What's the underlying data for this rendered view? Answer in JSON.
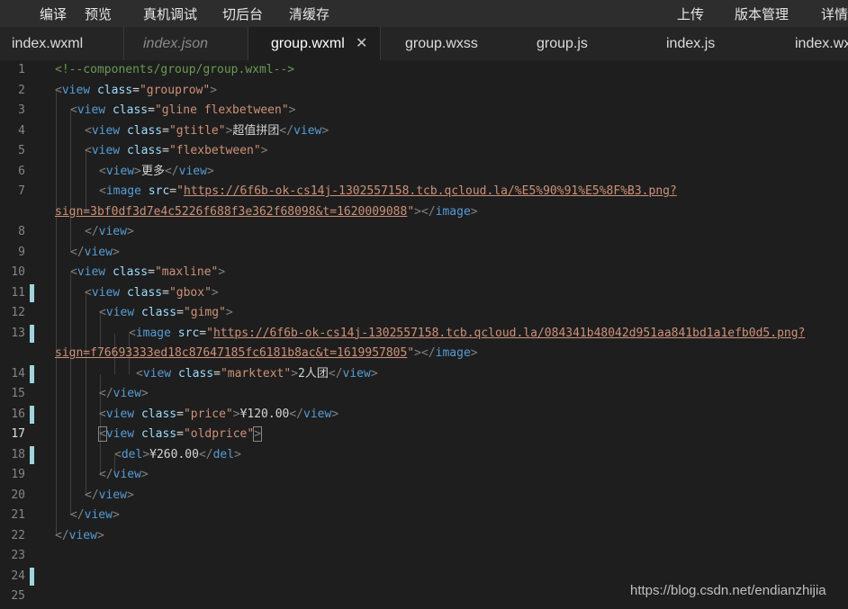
{
  "toolbar": {
    "compile": "编译",
    "preview": "预览",
    "remote_debug": "真机调试",
    "background": "切后台",
    "clear_cache": "清缓存",
    "upload": "上传",
    "version_mgmt": "版本管理",
    "details": "详情"
  },
  "tabs": [
    {
      "label": "index.wxml"
    },
    {
      "label": "index.json"
    },
    {
      "label": "group.wxml",
      "close": "✕"
    },
    {
      "label": "group.wxss"
    },
    {
      "label": "group.js"
    },
    {
      "label": "index.js"
    },
    {
      "label": "index.wxml"
    }
  ],
  "editor": {
    "line_numbers": [
      "1",
      "2",
      "3",
      "4",
      "5",
      "6",
      "7",
      "8",
      "9",
      "10",
      "11",
      "12",
      "13",
      "14",
      "15",
      "16",
      "17",
      "18",
      "19",
      "20",
      "21",
      "22",
      "23",
      "24",
      "25"
    ],
    "code": {
      "l1": {
        "comment": "<!--components/group/group.wxml-->"
      },
      "l2": {
        "open": "<",
        "tag": "view",
        "attr": "class",
        "eq": "=",
        "val": "\"grouprow\"",
        "close": ">"
      },
      "l3": {
        "open": "<",
        "tag": "view",
        "attr": "class",
        "eq": "=",
        "val": "\"gline flexbetween\"",
        "close": ">"
      },
      "l4": {
        "open": "<",
        "tag": "view",
        "attr": "class",
        "eq": "=",
        "val": "\"gtitle\"",
        "close": ">",
        "text": "超值拼团",
        "end_open": "</",
        "end_tag": "view",
        "end_close": ">"
      },
      "l5": {
        "open": "<",
        "tag": "view",
        "attr": "class",
        "eq": "=",
        "val": "\"flexbetween\"",
        "close": ">"
      },
      "l6": {
        "open": "<",
        "tag": "view",
        "close": ">",
        "text": "更多",
        "end_open": "</",
        "end_tag": "view",
        "end_close": ">"
      },
      "l7a": {
        "open": "<",
        "tag": "image",
        "attr": "src",
        "eq": "=",
        "q": "\"",
        "url": "https://6f6b-ok-cs14j-1302557158.tcb.qcloud.la/%E5%90%91%E5%8F%B3.png?"
      },
      "l7b": {
        "url": "sign=3bf0df3d7e4c5226f688f3e362f68098&t=1620009088",
        "q": "\"",
        "close": ">",
        "end_open": "</",
        "end_tag": "image",
        "end_close": ">"
      },
      "l8": {
        "end_open": "</",
        "end_tag": "view",
        "end_close": ">"
      },
      "l9": {
        "end_open": "</",
        "end_tag": "view",
        "end_close": ">"
      },
      "l10": {
        "open": "<",
        "tag": "view",
        "attr": "class",
        "eq": "=",
        "val": "\"maxline\"",
        "close": ">"
      },
      "l11": {
        "open": "<",
        "tag": "view",
        "attr": "class",
        "eq": "=",
        "val": "\"gbox\"",
        "close": ">"
      },
      "l12": {
        "open": "<",
        "tag": "view",
        "attr": "class",
        "eq": "=",
        "val": "\"gimg\"",
        "close": ">"
      },
      "l13a": {
        "open": "<",
        "tag": "image",
        "attr": "src",
        "eq": "=",
        "q": "\"",
        "url": "https://6f6b-ok-cs14j-1302557158.tcb.qcloud.la/084341b48042d951aa841bd1a1efb0d5.png?"
      },
      "l13b": {
        "url": "sign=f76693333ed18c87647185fc6181b8ac&t=1619957805",
        "q": "\"",
        "close": ">",
        "end_open": "</",
        "end_tag": "image",
        "end_close": ">"
      },
      "l14": {
        "open": "<",
        "tag": "view",
        "attr": "class",
        "eq": "=",
        "val": "\"marktext\"",
        "close": ">",
        "text": "2人团",
        "end_open": "</",
        "end_tag": "view",
        "end_close": ">"
      },
      "l15": {
        "end_open": "</",
        "end_tag": "view",
        "end_close": ">"
      },
      "l16": {
        "open": "<",
        "tag": "view",
        "attr": "class",
        "eq": "=",
        "val": "\"price\"",
        "close": ">",
        "text": "¥120.00",
        "end_open": "</",
        "end_tag": "view",
        "end_close": ">"
      },
      "l17": {
        "open": "<",
        "tag": "view",
        "attr": "class",
        "eq": "=",
        "val": "\"oldprice\"",
        "close": ">"
      },
      "l18": {
        "open": "<",
        "tag": "del",
        "close": ">",
        "text": "¥260.00",
        "end_open": "</",
        "end_tag": "del",
        "end_close": ">"
      },
      "l19": {
        "end_open": "</",
        "end_tag": "view",
        "end_close": ">"
      },
      "l20": {
        "end_open": "</",
        "end_tag": "view",
        "end_close": ">"
      },
      "l21": {
        "end_open": "</",
        "end_tag": "view",
        "end_close": ">"
      },
      "l22": {
        "end_open": "</",
        "end_tag": "view",
        "end_close": ">"
      }
    }
  },
  "watermark": "https://blog.csdn.net/endianzhijia",
  "colors": {
    "background": "#1e1e1e",
    "tag": "#569cd6",
    "attribute": "#9cdcfe",
    "string": "#ce9178",
    "comment": "#6a9955",
    "modified_marker": "#9fd4dd"
  }
}
